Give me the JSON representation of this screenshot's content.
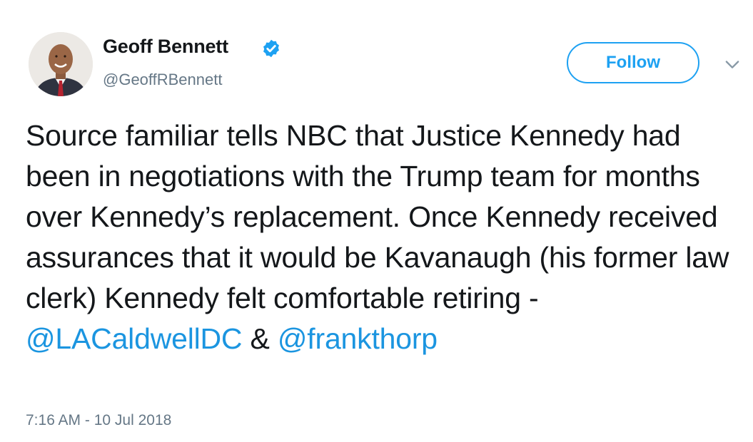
{
  "author": {
    "name": "Geoff Bennett",
    "handle": "@GeoffRBennett",
    "verified": true,
    "avatar_icon": "profile-photo"
  },
  "actions": {
    "follow_label": "Follow",
    "menu_icon": "chevron-down-icon"
  },
  "tweet": {
    "text_before": "Source familiar tells NBC that Justice Kennedy had been in negotiations with the Trump team for months over Kennedy’s replacement. Once Kennedy received assurances that it would be Kavanaugh (his former law clerk) Kennedy felt comfortable retiring - ",
    "mention_1": "@LACaldwellDC",
    "separator": " & ",
    "mention_2": "@frankthorp",
    "timestamp": "7:16 AM - 10 Jul 2018"
  },
  "colors": {
    "accent": "#1da1f2",
    "link": "#1b95e0",
    "text": "#14171a",
    "secondary_text": "#657786"
  }
}
